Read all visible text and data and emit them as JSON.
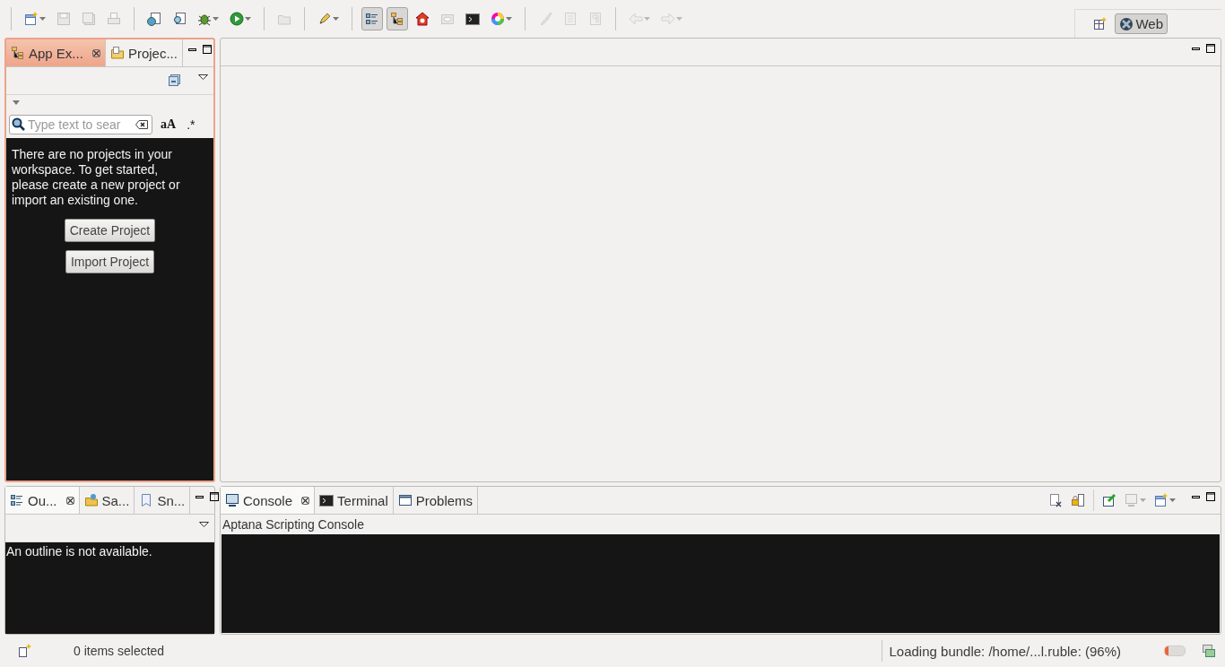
{
  "toolbar": {
    "items": [
      {
        "kind": "button",
        "disabled": false,
        "dropdown": true,
        "selected": false
      },
      {
        "kind": "button",
        "disabled": true,
        "dropdown": false,
        "selected": false
      },
      {
        "kind": "button",
        "disabled": true,
        "dropdown": false,
        "selected": false
      },
      {
        "kind": "button",
        "disabled": true,
        "dropdown": false,
        "selected": false
      },
      {
        "kind": "separator"
      },
      {
        "kind": "button",
        "disabled": false,
        "dropdown": false,
        "selected": false
      },
      {
        "kind": "button",
        "disabled": false,
        "dropdown": false,
        "selected": false
      },
      {
        "kind": "button",
        "disabled": false,
        "dropdown": true,
        "selected": false
      },
      {
        "kind": "button",
        "disabled": false,
        "dropdown": true,
        "selected": false
      },
      {
        "kind": "separator"
      },
      {
        "kind": "button",
        "disabled": true,
        "dropdown": false,
        "selected": false
      },
      {
        "kind": "separator"
      },
      {
        "kind": "button",
        "disabled": false,
        "dropdown": true,
        "selected": false
      },
      {
        "kind": "separator"
      },
      {
        "kind": "button",
        "disabled": false,
        "dropdown": false,
        "selected": true
      },
      {
        "kind": "button",
        "disabled": false,
        "dropdown": false,
        "selected": true
      },
      {
        "kind": "button",
        "disabled": false,
        "dropdown": false,
        "selected": false
      },
      {
        "kind": "button",
        "disabled": true,
        "dropdown": false,
        "selected": false
      },
      {
        "kind": "button",
        "disabled": false,
        "dropdown": false,
        "selected": false
      },
      {
        "kind": "button",
        "disabled": false,
        "dropdown": true,
        "selected": false
      },
      {
        "kind": "separator"
      },
      {
        "kind": "button",
        "disabled": true,
        "dropdown": false,
        "selected": false
      },
      {
        "kind": "button",
        "disabled": true,
        "dropdown": false,
        "selected": false
      },
      {
        "kind": "button",
        "disabled": true,
        "dropdown": false,
        "selected": false
      },
      {
        "kind": "separator"
      },
      {
        "kind": "button",
        "disabled": true,
        "dropdown": true,
        "selected": false
      },
      {
        "kind": "button",
        "disabled": true,
        "dropdown": true,
        "selected": false
      }
    ],
    "perspective": {
      "label": "Web",
      "selected": true
    }
  },
  "explorer": {
    "active": true,
    "tabs": [
      {
        "label": "App Ex...",
        "selected": true
      },
      {
        "label": "Projec...",
        "selected": false
      }
    ],
    "search": {
      "placeholder": "Type text to sear"
    },
    "case_toggle": "aA",
    "regex_toggle": ".*",
    "message": "There are no projects in your workspace. To get started, please create a new project or import an existing one.",
    "buttons": [
      "Create Project",
      "Import Project"
    ]
  },
  "outline": {
    "active": false,
    "tabs": [
      {
        "label": "Ou...",
        "selected": true
      },
      {
        "label": "Sa...",
        "selected": false
      },
      {
        "label": "Sn...",
        "selected": false
      }
    ],
    "message": "An outline is not available."
  },
  "console": {
    "active": false,
    "tabs": [
      {
        "label": "Console",
        "selected": true
      },
      {
        "label": "Terminal",
        "selected": false
      },
      {
        "label": "Problems",
        "selected": false
      }
    ],
    "title": "Aptana Scripting Console"
  },
  "status_bar": {
    "selection": "0 items selected",
    "progress_text": "Loading bundle: /home/...l.ruble: (96%)",
    "heap": {
      "level": 0.2
    }
  }
}
